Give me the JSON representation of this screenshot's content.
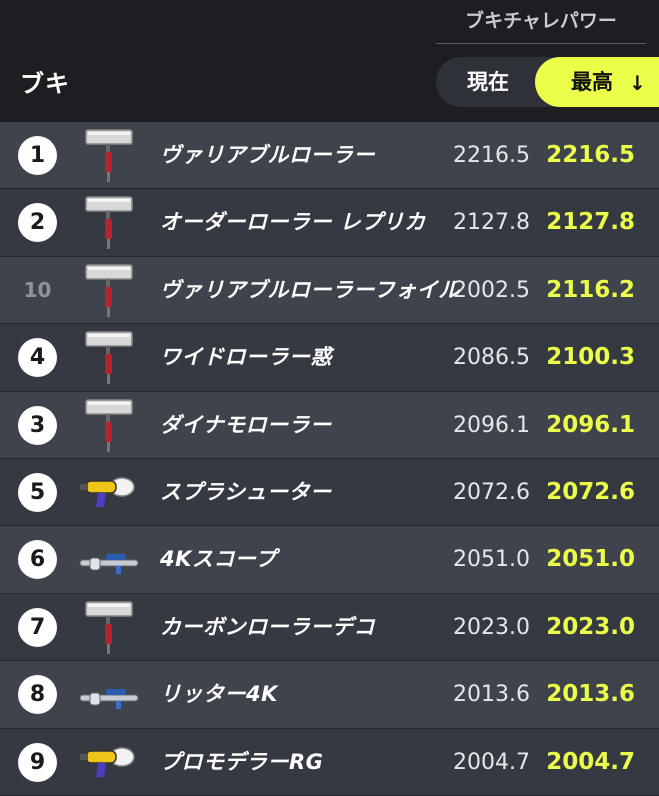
{
  "header": {
    "weapon_label": "ブキ",
    "power_title": "ブキチャレパワー",
    "sort_current_label": "現在",
    "sort_best_label": "最高",
    "sort_arrow": "↓"
  },
  "colors": {
    "accent": "#ebff4a",
    "row_light": "#3e434c",
    "row_dark": "#353941"
  },
  "rows": [
    {
      "rank": "1",
      "name": "ヴァリアブルローラー",
      "current": "2216.5",
      "best": "2216.5",
      "icon": "roller-icon",
      "ranked": true
    },
    {
      "rank": "2",
      "name": "オーダーローラー レプリカ",
      "current": "2127.8",
      "best": "2127.8",
      "icon": "roller-icon",
      "ranked": true
    },
    {
      "rank": "10",
      "name": "ヴァリアブルローラーフォイル",
      "current": "2002.5",
      "best": "2116.2",
      "icon": "roller-icon",
      "ranked": false
    },
    {
      "rank": "4",
      "name": "ワイドローラー惑",
      "current": "2086.5",
      "best": "2100.3",
      "icon": "roller-icon",
      "ranked": true
    },
    {
      "rank": "3",
      "name": "ダイナモローラー",
      "current": "2096.1",
      "best": "2096.1",
      "icon": "roller-icon",
      "ranked": true
    },
    {
      "rank": "5",
      "name": "スプラシューター",
      "current": "2072.6",
      "best": "2072.6",
      "icon": "shooter-icon",
      "ranked": true
    },
    {
      "rank": "6",
      "name": "4Kスコープ",
      "current": "2051.0",
      "best": "2051.0",
      "icon": "charger-icon",
      "ranked": true
    },
    {
      "rank": "7",
      "name": "カーボンローラーデコ",
      "current": "2023.0",
      "best": "2023.0",
      "icon": "roller-icon",
      "ranked": true
    },
    {
      "rank": "8",
      "name": "リッター4K",
      "current": "2013.6",
      "best": "2013.6",
      "icon": "charger-icon",
      "ranked": true
    },
    {
      "rank": "9",
      "name": "プロモデラーRG",
      "current": "2004.7",
      "best": "2004.7",
      "icon": "shooter-icon",
      "ranked": true
    }
  ]
}
